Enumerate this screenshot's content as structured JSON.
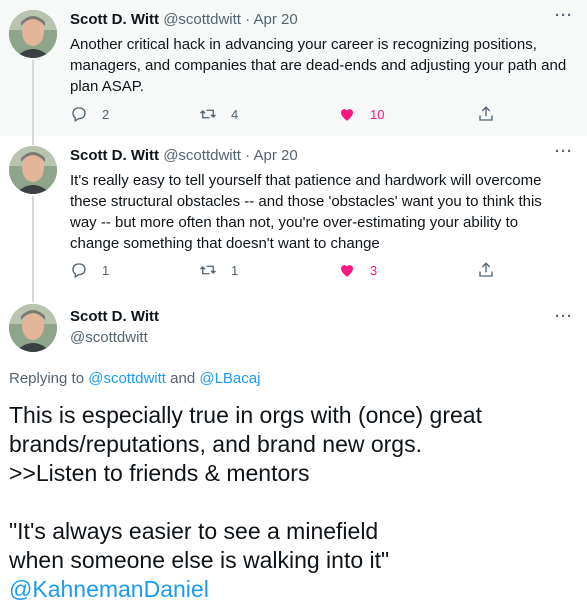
{
  "tweets": [
    {
      "name": "Scott D. Witt",
      "handle": "@scottdwitt",
      "sep": "·",
      "date": "Apr 20",
      "text": "Another critical hack in advancing your career is recognizing positions, managers, and companies that are dead-ends and adjusting your path and plan ASAP.",
      "replies": "2",
      "retweets": "4",
      "likes": "10"
    },
    {
      "name": "Scott D. Witt",
      "handle": "@scottdwitt",
      "sep": "·",
      "date": "Apr 20",
      "text": "It's really easy to tell yourself that patience and hardwork will overcome these structural obstacles -- and those 'obstacles' want you to think this way -- but more often than not, you're over-estimating your ability to change something that doesn't want to change",
      "replies": "1",
      "retweets": "1",
      "likes": "3"
    }
  ],
  "main_tweet": {
    "name": "Scott D. Witt",
    "handle": "@scottdwitt",
    "replying_prefix": "Replying to ",
    "replying_user1": "@scottdwitt",
    "replying_and": " and ",
    "replying_user2": "@LBacaj",
    "line1": "This is especially true in orgs with (once) great",
    "line2": "brands/reputations, and brand new orgs.",
    "line3": ">>Listen to friends & mentors",
    "line4": "\"It's always easier to see a minefield",
    "line5": "when someone else is walking into it\"",
    "mention": "@KahnemanDaniel"
  },
  "more_label": "···",
  "colors": {
    "accent": "#1d9bf0",
    "like": "#f91880",
    "muted": "#536471",
    "thread_line": "#cfd9de"
  }
}
